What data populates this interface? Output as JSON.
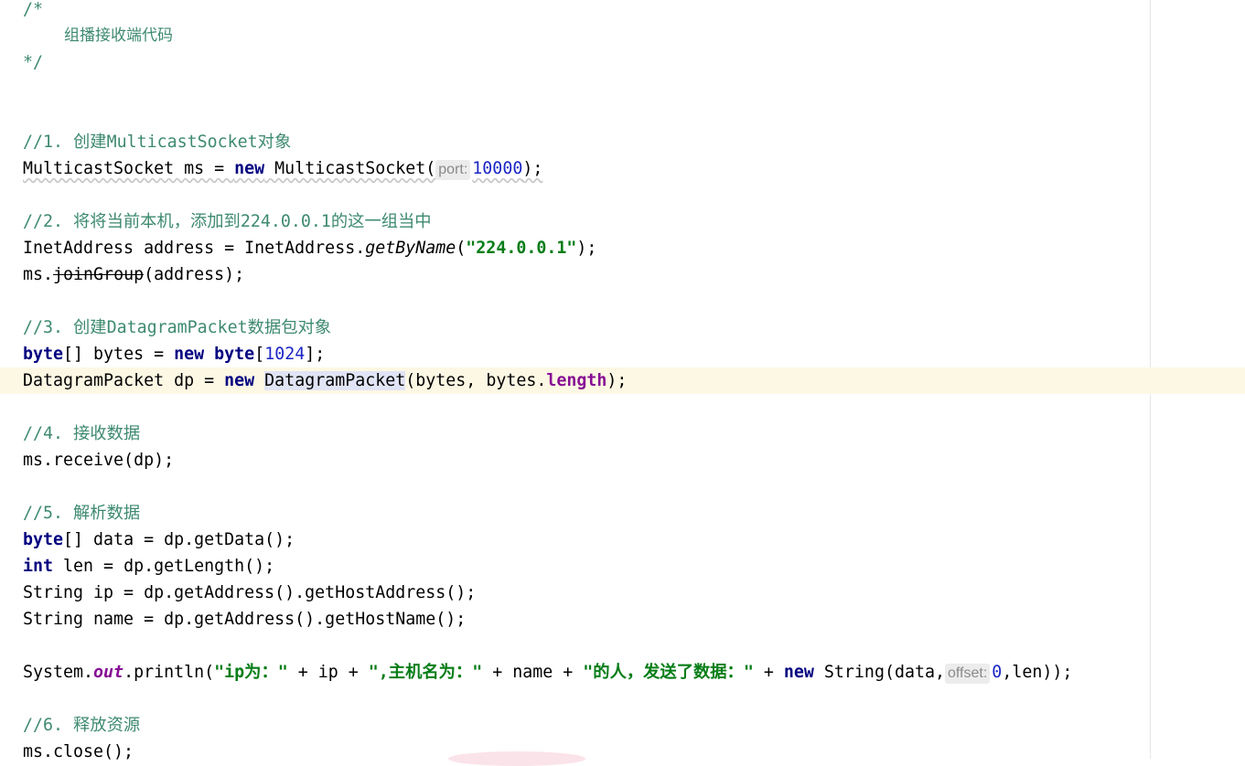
{
  "editor": {
    "header_comment": {
      "open": "/*",
      "text": "组播接收端代码",
      "close": "*/"
    },
    "step1": {
      "comment": "//1. 创建MulticastSocket对象",
      "code_a": "MulticastSocket ms = ",
      "kw_new": "new",
      "code_b": " MulticastSocket(",
      "hint": "port:",
      "port": "10000",
      "code_c": ");"
    },
    "step2": {
      "comment_a": "//2. 将将当前本机，添加到",
      "comment_b": "224.0.0.1",
      "comment_c": "的这一组当中",
      "code_a": "InetAddress address = InetAddress.",
      "method": "getByName",
      "paren_open": "(",
      "ip_string": "\"224.0.0.1\"",
      "paren_close": ");",
      "join_prefix": "ms.",
      "join_method": "joinGroup",
      "join_suffix": "(address);"
    },
    "step3": {
      "comment": "//3. 创建DatagramPacket数据包对象",
      "kw_byte": "byte",
      "code_a": "[] bytes = ",
      "kw_new": "new",
      "kw_byte2": "byte",
      "bracket_open": "[",
      "size": "1024",
      "bracket_close": "];",
      "code_b": "DatagramPacket dp = ",
      "kw_new2": "new",
      "sel_class": "DatagramPacket",
      "code_c": "(bytes, bytes.",
      "field_length": "length",
      "code_d": ");"
    },
    "step4": {
      "comment": "//4. 接收数据",
      "code": "ms.receive(dp);"
    },
    "step5": {
      "comment": "//5. 解析数据",
      "kw_byte": "byte",
      "data_line": "[] data = dp.getData();",
      "kw_int": "int",
      "len_line": " len = dp.getLength();",
      "ip_line": "String ip = dp.getAddress().getHostAddress();",
      "name_line": "String name = dp.getAddress().getHostName();"
    },
    "println": {
      "code_a": "System.",
      "out": "out",
      "code_b": ".println(",
      "str1": "\"ip为：\"",
      "code_c": " + ip + ",
      "str2": "\",主机名为：\"",
      "code_d": " + name + ",
      "str3": "\"的人，发送了数据：\"",
      "code_e": " + ",
      "kw_new": "new",
      "code_f": " String(data,",
      "hint": "offset:",
      "zero": "0",
      "code_g": ",len));"
    },
    "step6": {
      "comment": "//6. 释放资源",
      "code": "ms.close();"
    }
  }
}
